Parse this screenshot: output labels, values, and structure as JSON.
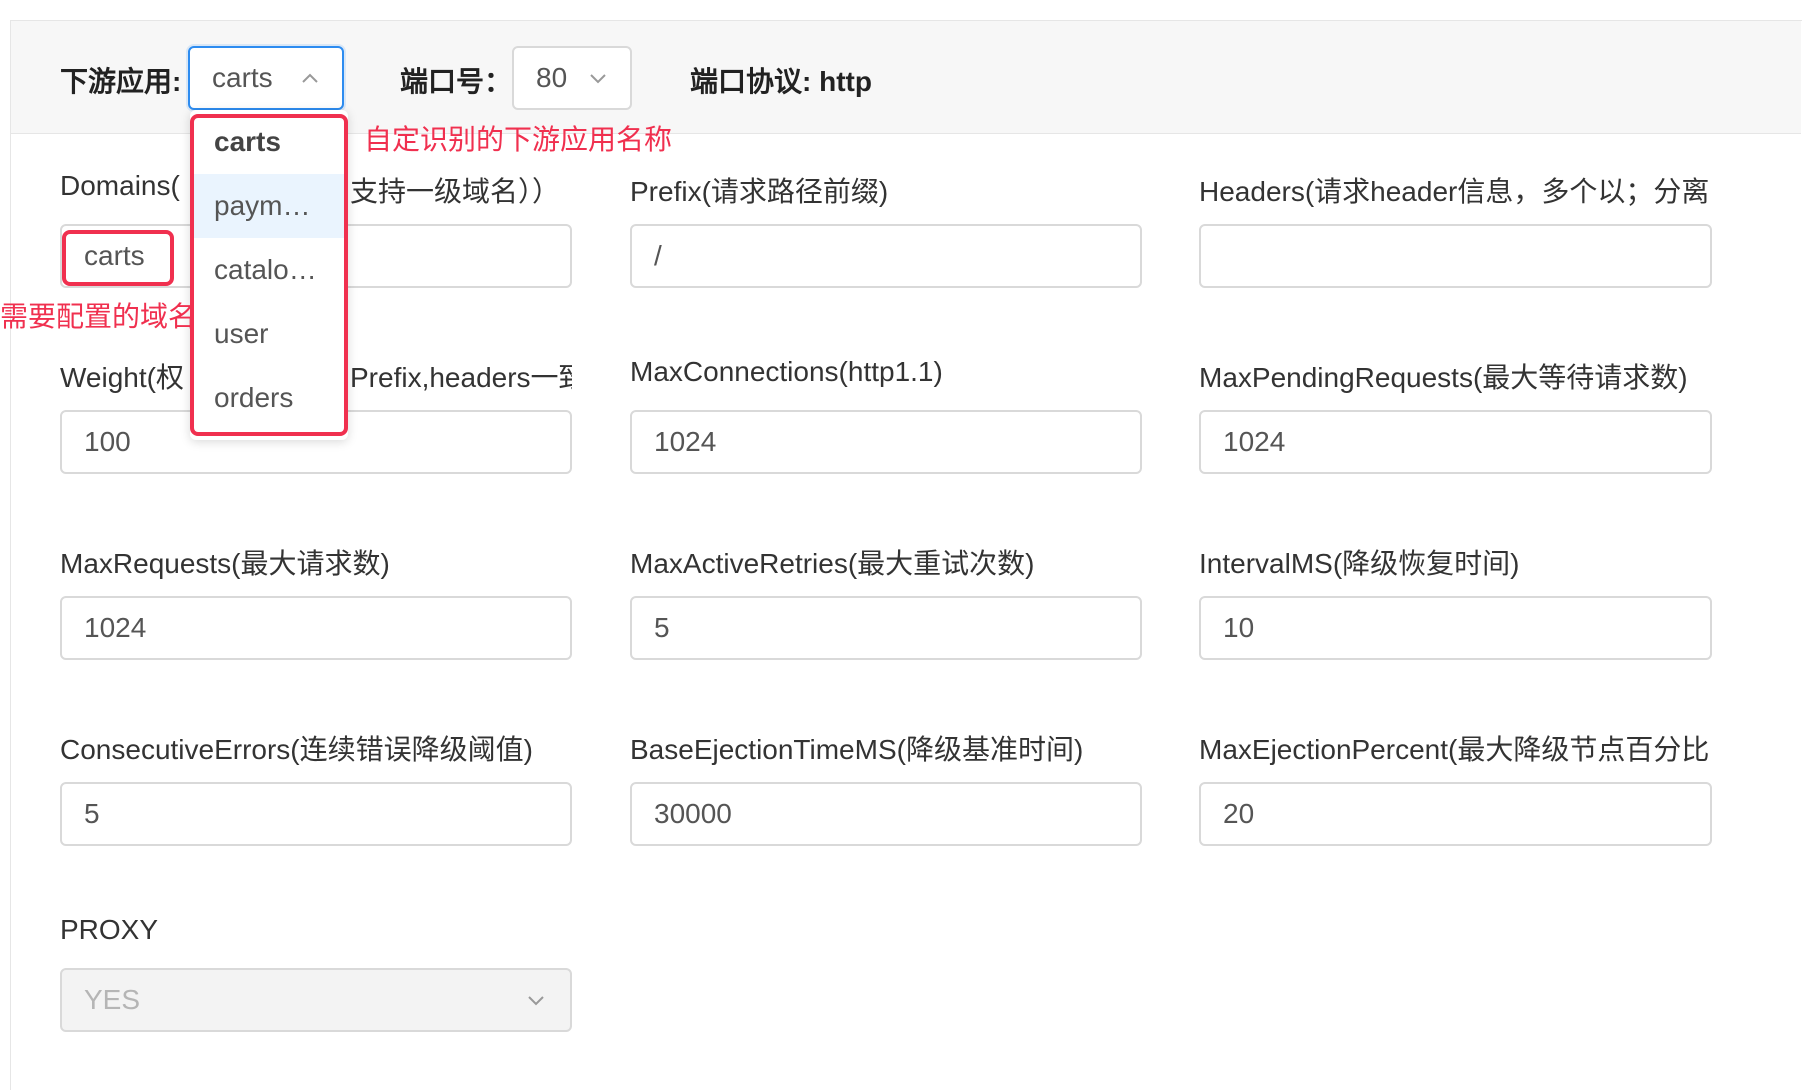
{
  "header": {
    "app_label": "下游应用:",
    "app_value": "carts",
    "port_label": "端口号：",
    "port_value": "80",
    "protocol_label": "端口协议: http"
  },
  "dropdown": {
    "items": [
      "carts",
      "paym…",
      "catalo…",
      "user",
      "orders"
    ]
  },
  "annotations": {
    "dropdown_note": "自定识别的下游应用名称",
    "domain_note": "需要配置的域名"
  },
  "fields": {
    "domains": {
      "label": "Domains(请…支持一级域名））",
      "label_left": "Domains(",
      "label_right": "支持一级域名））",
      "value": "carts"
    },
    "prefix": {
      "label": "Prefix(请求路径前缀)",
      "value": "/"
    },
    "headers": {
      "label": "Headers(请求header信息，多个以；分离",
      "value": ""
    },
    "weight": {
      "label_left": "Weight(权",
      "label_right": "Prefix,headers一致",
      "value": "100"
    },
    "max_connections": {
      "label": "MaxConnections(http1.1)",
      "value": "1024"
    },
    "max_pending": {
      "label": "MaxPendingRequests(最大等待请求数)",
      "value": "1024"
    },
    "max_requests": {
      "label": "MaxRequests(最大请求数)",
      "value": "1024"
    },
    "max_active_retries": {
      "label": "MaxActiveRetries(最大重试次数)",
      "value": "5"
    },
    "interval_ms": {
      "label": "IntervalMS(降级恢复时间)",
      "value": "10"
    },
    "consecutive_errors": {
      "label": "ConsecutiveErrors(连续错误降级阈值)",
      "value": "5"
    },
    "base_ejection": {
      "label": "BaseEjectionTimeMS(降级基准时间)",
      "value": "30000"
    },
    "max_ejection": {
      "label": "MaxEjectionPercent(最大降级节点百分比",
      "value": "20"
    },
    "proxy": {
      "label": "PROXY",
      "value": "YES"
    }
  },
  "colors": {
    "accent": "#2d8cf0",
    "annotation": "#f0304f",
    "hover_bg": "#eaf4fe"
  },
  "icons": {
    "app_caret": "chevron-up-icon",
    "port_caret": "chevron-down-icon",
    "proxy_caret": "chevron-down-icon"
  }
}
